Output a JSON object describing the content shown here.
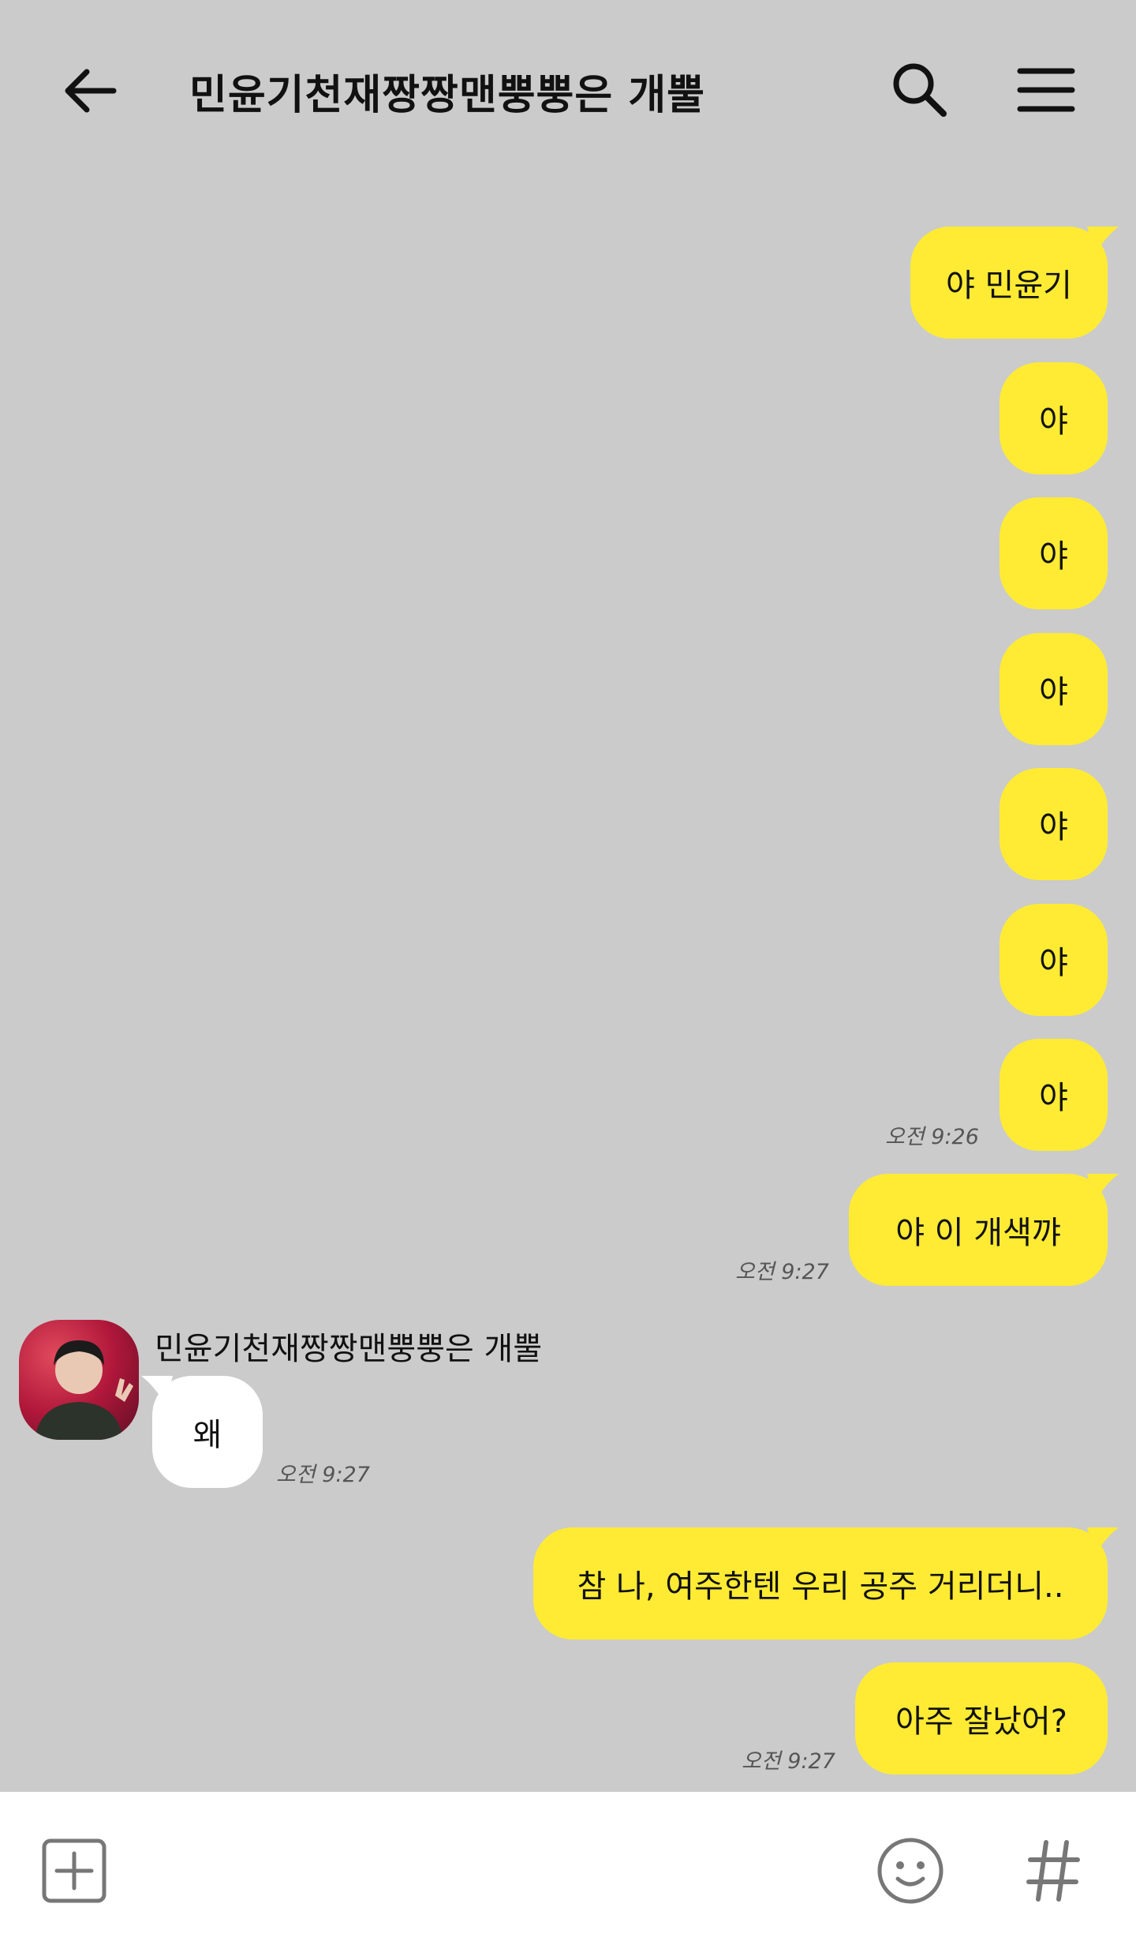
{
  "header": {
    "title": "민윤기천재짱짱맨뿡뿡은 개뿔",
    "back_icon": "arrow-left-icon",
    "search_icon": "search-icon",
    "menu_icon": "hamburger-menu-icon"
  },
  "messages": [
    {
      "from": "me",
      "text": "야 민윤기"
    },
    {
      "from": "me",
      "text": "야"
    },
    {
      "from": "me",
      "text": "야"
    },
    {
      "from": "me",
      "text": "야"
    },
    {
      "from": "me",
      "text": "야"
    },
    {
      "from": "me",
      "text": "야"
    },
    {
      "from": "me",
      "text": "야",
      "time": "오전 9:26"
    },
    {
      "from": "me",
      "text": "야 이 개색꺄",
      "time": "오전 9:27"
    },
    {
      "from": "other",
      "sender": "민윤기천재짱짱맨뿡뿡은 개뿔",
      "text": "왜",
      "time": "오전 9:27"
    },
    {
      "from": "me",
      "text": "참 나, 여주한텐 우리 공주 거리더니.."
    },
    {
      "from": "me",
      "text": "아주 잘났어?",
      "time": "오전 9:27"
    }
  ],
  "input_bar": {
    "plus_icon": "plus-box-icon",
    "emoji_icon": "smiley-icon",
    "hash_icon": "hash-icon"
  },
  "colors": {
    "background": "#cbcbcb",
    "my_bubble": "#ffeb33",
    "other_bubble": "#ffffff"
  }
}
